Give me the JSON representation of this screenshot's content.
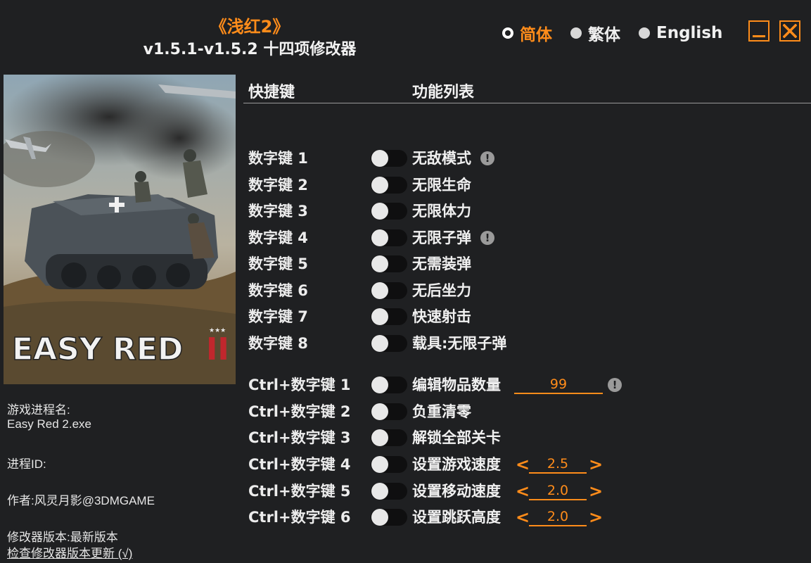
{
  "header": {
    "game_title": "《浅红2》",
    "subtitle": "v1.5.1-v1.5.2 十四项修改器"
  },
  "language": {
    "options": [
      {
        "label": "简体",
        "selected": true
      },
      {
        "label": "繁体",
        "selected": false
      },
      {
        "label": "English",
        "selected": false
      }
    ]
  },
  "window_controls": {
    "minimize_icon": "minimize-icon",
    "close_icon": "close-icon",
    "accent": "#ff8c1a"
  },
  "cover": {
    "logo_text": "EASY RED",
    "logo_numeral": "II",
    "stars": "★★★"
  },
  "info": {
    "process_name_label": "游戏进程名:",
    "process_name_value": "Easy Red 2.exe",
    "process_id_label": "进程ID:",
    "author": "作者:风灵月影@3DMGAME",
    "version": "修改器版本:最新版本",
    "check_update": "检查修改器版本更新 (√)"
  },
  "table": {
    "col_hotkey": "快捷键",
    "col_features": "功能列表",
    "rows": [
      {
        "hotkey": "数字键 1",
        "feature": "无敌模式",
        "warn": "!"
      },
      {
        "hotkey": "数字键 2",
        "feature": "无限生命"
      },
      {
        "hotkey": "数字键 3",
        "feature": "无限体力"
      },
      {
        "hotkey": "数字键 4",
        "feature": "无限子弹",
        "warn": "!"
      },
      {
        "hotkey": "数字键 5",
        "feature": "无需装弹"
      },
      {
        "hotkey": "数字键 6",
        "feature": "无后坐力"
      },
      {
        "hotkey": "数字键 7",
        "feature": "快速射击"
      },
      {
        "hotkey": "数字键 8",
        "feature": "载具:无限子弹"
      },
      {
        "hotkey": "Ctrl+数字键 1",
        "feature": "编辑物品数量",
        "value": "99",
        "warn": "!"
      },
      {
        "hotkey": "Ctrl+数字键 2",
        "feature": "负重清零"
      },
      {
        "hotkey": "Ctrl+数字键 3",
        "feature": "解锁全部关卡"
      },
      {
        "hotkey": "Ctrl+数字键 4",
        "feature": "设置游戏速度",
        "value": "2.5",
        "left_arrow": "<",
        "right_arrow": ">"
      },
      {
        "hotkey": "Ctrl+数字键 5",
        "feature": "设置移动速度",
        "value": "2.0",
        "left_arrow": "<",
        "right_arrow": ">"
      },
      {
        "hotkey": "Ctrl+数字键 6",
        "feature": "设置跳跃高度",
        "value": "2.0",
        "left_arrow": "<",
        "right_arrow": ">"
      }
    ]
  }
}
